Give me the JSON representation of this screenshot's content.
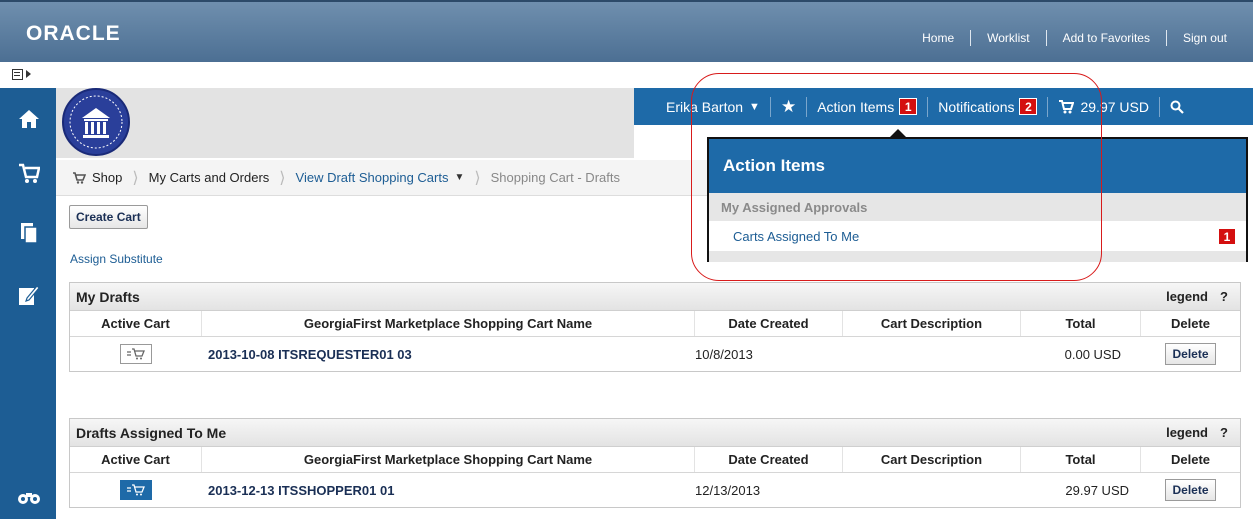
{
  "header": {
    "logo": "ORACLE",
    "links": [
      "Home",
      "Worklist",
      "Add to Favorites",
      "Sign out"
    ]
  },
  "userbar": {
    "user": "Erika Barton",
    "action_items_label": "Action Items",
    "action_items_count": "1",
    "notifications_label": "Notifications",
    "notifications_count": "2",
    "cart_total": "29.97 USD"
  },
  "breadcrumb": {
    "shop": "Shop",
    "carts_orders": "My Carts and Orders",
    "view_draft": "View Draft Shopping Carts",
    "current": "Shopping Cart - Drafts"
  },
  "actions": {
    "create_cart": "Create Cart",
    "assign_substitute": "Assign Substitute"
  },
  "columns": [
    "Active Cart",
    "GeorgiaFirst Marketplace Shopping Cart Name",
    "Date Created",
    "Cart Description",
    "Total",
    "Delete"
  ],
  "my_drafts": {
    "title": "My Drafts",
    "legend": "legend",
    "help": "?",
    "rows": [
      {
        "name": "2013-10-08 ITSREQUESTER01 03",
        "date": "10/8/2013",
        "description": "",
        "total": "0.00 USD",
        "delete": "Delete"
      }
    ]
  },
  "drafts_assigned": {
    "title": "Drafts Assigned To Me",
    "legend": "legend",
    "help": "?",
    "rows": [
      {
        "name": "2013-12-13 ITSSHOPPER01 01",
        "date": "12/13/2013",
        "description": "",
        "total": "29.97 USD",
        "delete": "Delete"
      }
    ]
  },
  "dropdown": {
    "title": "Action Items",
    "section": "My Assigned Approvals",
    "item": "Carts Assigned To Me",
    "item_count": "1"
  },
  "colors": {
    "brand_blue": "#1e6aa8",
    "badge_red": "#d40f0f",
    "highlight_red": "#d81b1b"
  }
}
